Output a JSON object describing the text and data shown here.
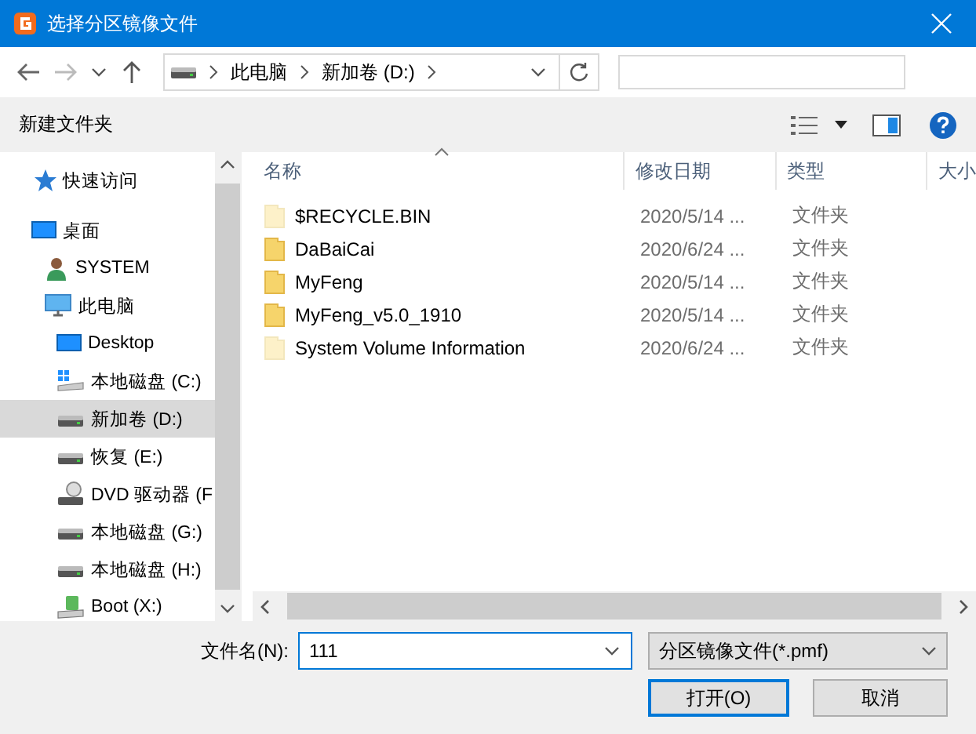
{
  "window": {
    "title": "选择分区镜像文件"
  },
  "address": {
    "crumbs": [
      "此电脑",
      "新加卷 (D:)"
    ]
  },
  "toolbar": {
    "new_folder": "新建文件夹"
  },
  "sidebar": {
    "items": [
      {
        "label": "快速访问",
        "kind": "star",
        "selected": false
      },
      {
        "label": "桌面",
        "kind": "desktop",
        "selected": false,
        "children": [
          {
            "label": "SYSTEM",
            "kind": "user",
            "selected": false
          },
          {
            "label": "此电脑",
            "kind": "pc",
            "selected": false,
            "children": [
              {
                "label": "Desktop",
                "kind": "desktop",
                "selected": false
              },
              {
                "label": "本地磁盘 (C:)",
                "kind": "windrive",
                "selected": false
              },
              {
                "label": "新加卷 (D:)",
                "kind": "drive",
                "selected": true
              },
              {
                "label": "恢复 (E:)",
                "kind": "drive",
                "selected": false
              },
              {
                "label": "DVD 驱动器 (F",
                "kind": "dvd",
                "selected": false
              },
              {
                "label": "本地磁盘 (G:)",
                "kind": "drive",
                "selected": false
              },
              {
                "label": "本地磁盘 (H:)",
                "kind": "drive",
                "selected": false
              },
              {
                "label": "Boot (X:)",
                "kind": "usb",
                "selected": false
              }
            ]
          }
        ]
      }
    ]
  },
  "table": {
    "columns": [
      "名称",
      "修改日期",
      "类型",
      "大小"
    ],
    "rows": [
      {
        "name": "$RECYCLE.BIN",
        "date": "2020/5/14 ...",
        "type": "文件夹",
        "hidden": true
      },
      {
        "name": "DaBaiCai",
        "date": "2020/6/24 ...",
        "type": "文件夹",
        "hidden": false
      },
      {
        "name": "MyFeng",
        "date": "2020/5/14 ...",
        "type": "文件夹",
        "hidden": false
      },
      {
        "name": "MyFeng_v5.0_1910",
        "date": "2020/5/14 ...",
        "type": "文件夹",
        "hidden": false
      },
      {
        "name": "System Volume Information",
        "date": "2020/6/24 ...",
        "type": "文件夹",
        "hidden": true
      }
    ]
  },
  "footer": {
    "filename_label": "文件名(N):",
    "filename_value": "111",
    "filetype": "分区镜像文件(*.pmf)",
    "open": "打开(O)",
    "cancel": "取消"
  }
}
